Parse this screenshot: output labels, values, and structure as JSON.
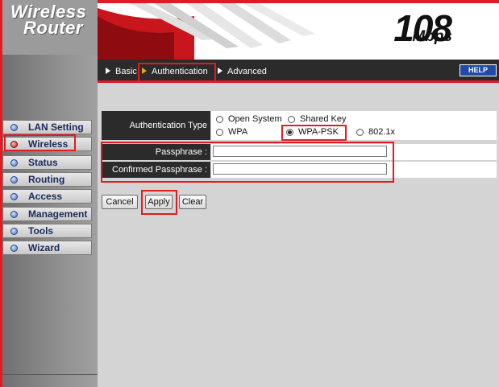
{
  "logo": {
    "line1": "Wireless",
    "line2": "Router"
  },
  "banner": {
    "speed": "108",
    "unit": "Mbps"
  },
  "nav": {
    "basic": "Basic",
    "authentication": "Authentication",
    "advanced": "Advanced",
    "help": "HELP"
  },
  "sidebar": {
    "items": [
      {
        "label": "LAN Setting",
        "active": false
      },
      {
        "label": "Wireless",
        "active": true
      },
      {
        "label": "Status",
        "active": false
      },
      {
        "label": "Routing",
        "active": false
      },
      {
        "label": "Access",
        "active": false
      },
      {
        "label": "Management",
        "active": false
      },
      {
        "label": "Tools",
        "active": false
      },
      {
        "label": "Wizard",
        "active": false
      }
    ]
  },
  "form": {
    "auth_type_label": "Authentication Type",
    "options": {
      "open_system": "Open System",
      "shared_key": "Shared Key",
      "wpa": "WPA",
      "wpa_psk": "WPA-PSK",
      "dot1x": "802.1x"
    },
    "selected_option": "WPA-PSK",
    "passphrase_label": "Passphrase :",
    "passphrase_value": "",
    "confirm_label": "Confirmed Passphrase :",
    "confirm_value": ""
  },
  "buttons": {
    "cancel": "Cancel",
    "apply": "Apply",
    "clear": "Clear"
  },
  "colors": {
    "highlight": "#e11b22",
    "dark_cell": "#2b2b2b",
    "content_bg": "#d4d4d4"
  }
}
